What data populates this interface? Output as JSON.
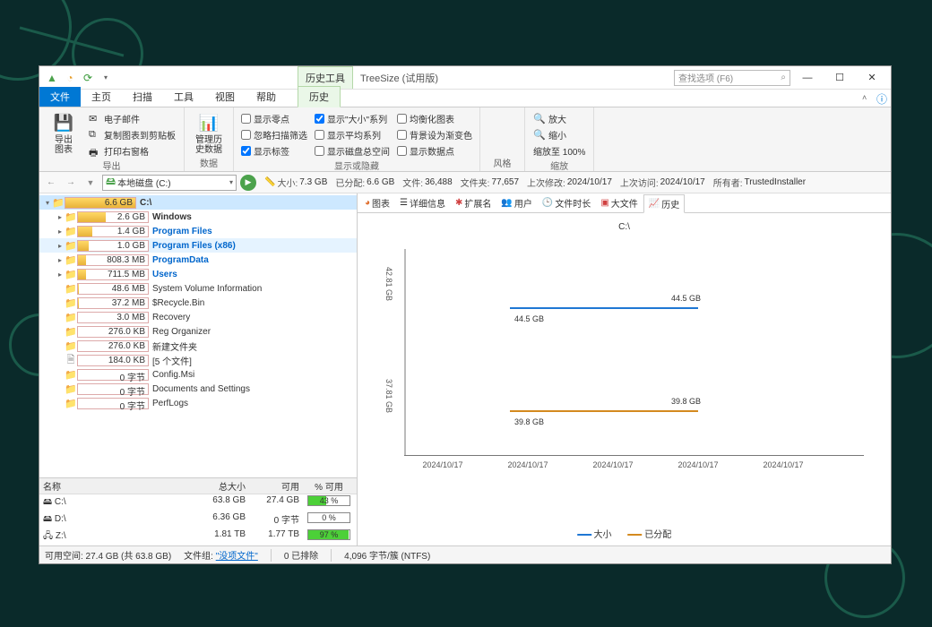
{
  "app": {
    "title": "TreeSize  (试用版)",
    "context_tab": "历史工具",
    "search_placeholder": "查找选项 (F6)"
  },
  "ribbontabs": {
    "file": "文件",
    "home": "主页",
    "scan": "扫描",
    "tools": "工具",
    "view": "视图",
    "help": "帮助",
    "history": "历史"
  },
  "ribbon": {
    "export": {
      "name": "导出",
      "big": "导出\n图表",
      "sm1": "电子邮件",
      "sm2": "复制图表到剪贴板",
      "sm3": "打印右窗格"
    },
    "data": {
      "name": "数据",
      "big": "管理历\n史数据"
    },
    "showhide": {
      "name": "显示或隐藏",
      "ck1": "显示零点",
      "ck2": "显示\"大小\"系列",
      "ck3": "均衡化图表",
      "ck4": "忽略扫描筛选",
      "ck5": "显示平均系列",
      "ck6": "背景设为渐变色",
      "ck7": "显示标签",
      "ck8": "显示磁盘总空间",
      "ck9": "显示数据点"
    },
    "style": {
      "name": "风格"
    },
    "zoom": {
      "name": "缩放",
      "in": "放大",
      "out": "缩小",
      "fit": "缩放至 100%"
    }
  },
  "nav": {
    "path_label": "本地磁盘 (C:)",
    "size_l": "大小:",
    "size_v": "7.3 GB",
    "alloc_l": "已分配:",
    "alloc_v": "6.6 GB",
    "files_l": "文件:",
    "files_v": "36,488",
    "folders_l": "文件夹:",
    "folders_v": "77,657",
    "mod_l": "上次修改:",
    "mod_v": "2024/10/17",
    "acc_l": "上次访问:",
    "acc_v": "2024/10/17",
    "own_l": "所有者:",
    "own_v": "TrustedInstaller"
  },
  "tree": [
    {
      "depth": 0,
      "tw": "v",
      "pct": 100,
      "size": "6.6 GB",
      "name": "C:\\",
      "sel": true,
      "bold": true
    },
    {
      "depth": 1,
      "tw": ">",
      "pct": 40,
      "size": "2.6 GB",
      "name": "Windows",
      "bold": true,
      "blue": false
    },
    {
      "depth": 1,
      "tw": ">",
      "pct": 21,
      "size": "1.4 GB",
      "name": "Program Files",
      "blue": true
    },
    {
      "depth": 1,
      "tw": ">",
      "pct": 15,
      "size": "1.0 GB",
      "name": "Program Files (x86)",
      "blue": true,
      "bold": true,
      "rowsel": true
    },
    {
      "depth": 1,
      "tw": ">",
      "pct": 12,
      "size": "808.3 MB",
      "name": "ProgramData",
      "blue": true
    },
    {
      "depth": 1,
      "tw": ">",
      "pct": 11,
      "size": "711.5 MB",
      "name": "Users",
      "blue": true
    },
    {
      "depth": 1,
      "tw": "",
      "pct": 1,
      "size": "48.6 MB",
      "name": "System Volume Information"
    },
    {
      "depth": 1,
      "tw": "",
      "pct": 1,
      "size": "37.2 MB",
      "name": "$Recycle.Bin"
    },
    {
      "depth": 1,
      "tw": "",
      "pct": 0,
      "size": "3.0 MB",
      "name": "Recovery"
    },
    {
      "depth": 1,
      "tw": "",
      "pct": 0,
      "size": "276.0 KB",
      "name": "Reg Organizer"
    },
    {
      "depth": 1,
      "tw": "",
      "pct": 0,
      "size": "276.0 KB",
      "name": "新建文件夹"
    },
    {
      "depth": 1,
      "tw": "",
      "pct": 0,
      "size": "184.0 KB",
      "name": "[5 个文件]",
      "file": true
    },
    {
      "depth": 1,
      "tw": "",
      "pct": 0,
      "size": "0 字节",
      "name": "Config.Msi"
    },
    {
      "depth": 1,
      "tw": "",
      "pct": 0,
      "size": "0 字节",
      "name": "Documents and Settings"
    },
    {
      "depth": 1,
      "tw": "",
      "pct": 0,
      "size": "0 字节",
      "name": "PerfLogs"
    }
  ],
  "drives": {
    "h_name": "名称",
    "h_total": "总大小",
    "h_free": "可用",
    "h_pct": "% 可用",
    "rows": [
      {
        "ic": "🖴",
        "name": "C:\\",
        "total": "63.8 GB",
        "free": "27.4 GB",
        "pct": "43 %",
        "pv": 43
      },
      {
        "ic": "🖴",
        "name": "D:\\",
        "total": "6.36 GB",
        "free": "0 字节",
        "pct": "0 %",
        "pv": 0
      },
      {
        "ic": "🖧",
        "name": "Z:\\",
        "total": "1.81 TB",
        "free": "1.77 TB",
        "pct": "97 %",
        "pv": 97
      }
    ]
  },
  "rtabs2": {
    "chart": "图表",
    "details": "详细信息",
    "ext": "扩展名",
    "users": "用户",
    "ages": "文件时长",
    "big": "大文件",
    "history": "历史"
  },
  "chart": {
    "title": "C:\\",
    "y1": "42.81 GB",
    "y2": "37.81 GB",
    "xticks": [
      "2024/10/17",
      "2024/10/17",
      "2024/10/17",
      "2024/10/17",
      "2024/10/17"
    ],
    "size_lbl_left": "44.5 GB",
    "size_lbl_right": "44.5 GB",
    "alloc_lbl_left": "39.8 GB",
    "alloc_lbl_right": "39.8 GB",
    "legend_size": "大小",
    "legend_alloc": "已分配"
  },
  "chart_data": {
    "type": "line",
    "title": "C:\\",
    "xlabel": "",
    "ylabel": "",
    "ylim": [
      37.81,
      42.81
    ],
    "x": [
      "2024/10/17",
      "2024/10/17",
      "2024/10/17",
      "2024/10/17",
      "2024/10/17"
    ],
    "series": [
      {
        "name": "大小",
        "color": "#1f77d4",
        "values": [
          44.5,
          44.5,
          44.5,
          44.5,
          44.5
        ],
        "unit": "GB"
      },
      {
        "name": "已分配",
        "color": "#d48a1f",
        "values": [
          39.8,
          39.8,
          39.8,
          39.8,
          39.8
        ],
        "unit": "GB"
      }
    ]
  },
  "status": {
    "free": "可用空间: 27.4 GB  (共 63.8 GB)",
    "filter_l": "文件组:",
    "filter_v": "\"没项文件\"",
    "excl": "0 已排除",
    "cluster": "4,096 字节/簇 (NTFS)"
  }
}
